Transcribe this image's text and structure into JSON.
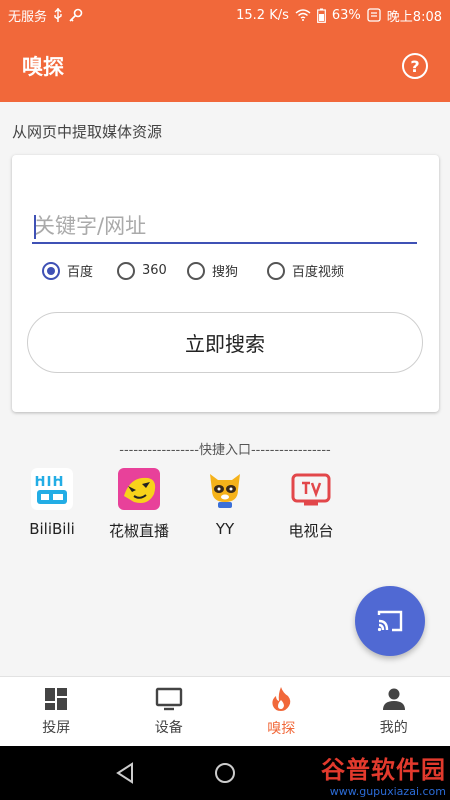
{
  "status_bar": {
    "carrier": "无服务",
    "speed": "15.2 K/s",
    "battery": "63%",
    "time": "晚上8:08"
  },
  "app_bar": {
    "title": "嗅探",
    "help_icon": "question-circle-icon",
    "help_symbol": "?"
  },
  "main": {
    "section_label": "从网页中提取媒体资源",
    "search": {
      "placeholder": "关键字/网址",
      "value": ""
    },
    "engines": [
      {
        "label": "百度",
        "selected": true
      },
      {
        "label": "360",
        "selected": false
      },
      {
        "label": "搜狗",
        "selected": false
      },
      {
        "label": "百度视频",
        "selected": false
      }
    ],
    "search_button": "立即搜索",
    "quick_header": "-----------------快捷入口-----------------",
    "quick_links": [
      {
        "label": "BiliBili",
        "icon": "bilibili-icon"
      },
      {
        "label": "花椒直播",
        "icon": "huajiao-icon"
      },
      {
        "label": "YY",
        "icon": "yy-icon"
      },
      {
        "label": "电视台",
        "icon": "tv-icon"
      }
    ],
    "fab_icon": "cast-icon"
  },
  "bottom_nav": [
    {
      "label": "投屏",
      "icon": "dashboard-icon",
      "active": false
    },
    {
      "label": "设备",
      "icon": "monitor-icon",
      "active": false
    },
    {
      "label": "嗅探",
      "icon": "flame-icon",
      "active": true
    },
    {
      "label": "我的",
      "icon": "person-icon",
      "active": false
    }
  ],
  "watermark": {
    "text": "谷普软件园",
    "url": "www.gupuxiazai.com"
  },
  "colors": {
    "accent": "#f1683a",
    "primary": "#3f51b5",
    "fab": "#5069d3"
  }
}
